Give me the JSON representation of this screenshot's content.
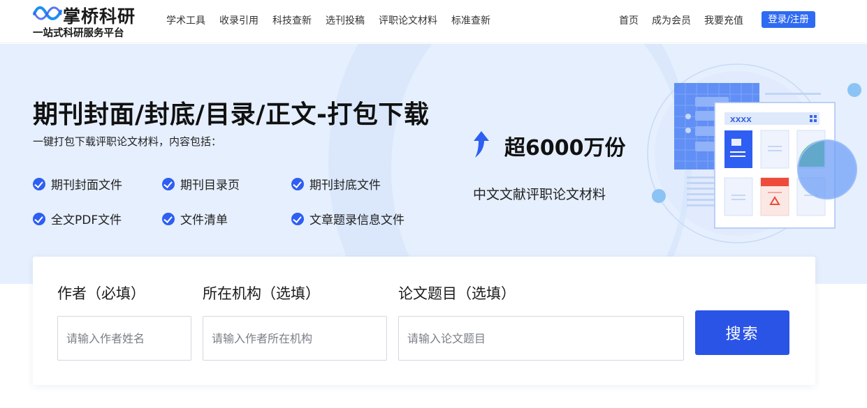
{
  "header": {
    "logo_name": "掌桥科研",
    "logo_slogan": "一站式科研服务平台",
    "nav": [
      "学术工具",
      "收录引用",
      "科技查新",
      "选刊投稿",
      "评职论文材料",
      "标准查新"
    ],
    "nav_right": [
      "首页",
      "成为会员",
      "我要充值"
    ],
    "login_label": "登录/注册"
  },
  "banner": {
    "title": "期刊封面/封底/目录/正文-打包下载",
    "subtitle": "一键打包下载评职论文材料，内容包括：",
    "features": [
      "期刊封面文件",
      "期刊目录页",
      "期刊封底文件",
      "全文PDF文件",
      "文件清单",
      "文章题录信息文件"
    ],
    "stat_value": "超6000万份",
    "stat_label": "中文文献评职论文材料",
    "illustration_text": "XXXX"
  },
  "search": {
    "author_label": "作者（必填）",
    "author_placeholder": "请输入作者姓名",
    "org_label": "所在机构（选填）",
    "org_placeholder": "请输入作者所在机构",
    "title_label": "论文题目（选填）",
    "title_placeholder": "请输入论文题目",
    "button_label": "搜索"
  },
  "colors": {
    "accent": "#2a54e6",
    "banner_bg": "#e6effd",
    "check": "#2f5ef2"
  }
}
